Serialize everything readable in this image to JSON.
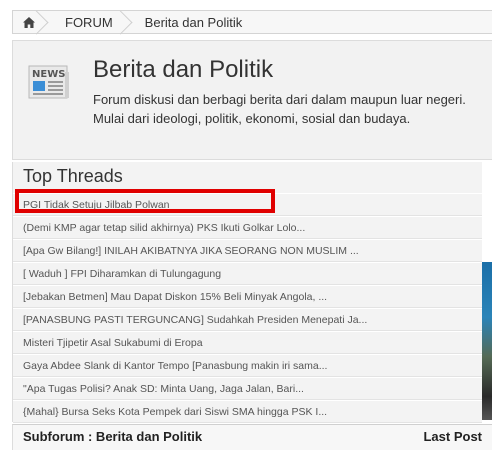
{
  "breadcrumb": {
    "home_icon": "home-icon",
    "items": [
      {
        "label": "FORUM"
      },
      {
        "label": "Berita dan Politik"
      }
    ]
  },
  "header": {
    "icon": "news-icon",
    "icon_label": "NEWS",
    "title": "Berita dan Politik",
    "description": "Forum diskusi dan berbagi berita dari dalam maupun luar negeri. Mulai dari ideologi, politik, ekonomi, sosial dan budaya."
  },
  "top_threads": {
    "title": "Top Threads",
    "items": [
      "PGI Tidak Setuju Jilbab Polwan",
      "(Demi KMP agar tetap silid akhirnya) PKS Ikuti Golkar Lolo...",
      "[Apa Gw Bilang!] INILAH AKIBATNYA JIKA SEORANG NON MUSLIM ...",
      "[ Waduh ] FPI Diharamkan di Tulungagung",
      "[Jebakan Betmen] Mau Dapat Diskon 15% Beli Minyak Angola, ...",
      "[PANASBUNG PASTI TERGUNCANG] Sudahkah Presiden Menepati Ja...",
      "Misteri Tjipetir Asal Sukabumi di Eropa",
      "Gaya Abdee Slank di Kantor Tempo [Panasbung makin iri sama...",
      "\"Apa Tugas Polisi? Anak SD: Minta Uang, Jaga Jalan, Bari...",
      "{Mahal} Bursa Seks Kota Pempek dari Siswi SMA hingga PSK I..."
    ]
  },
  "subforum": {
    "title": "Subforum : Berita dan Politik",
    "last_post_label": "Last Post"
  },
  "colors": {
    "highlight": "#e00000",
    "panel_bg": "#f2f2f2"
  }
}
